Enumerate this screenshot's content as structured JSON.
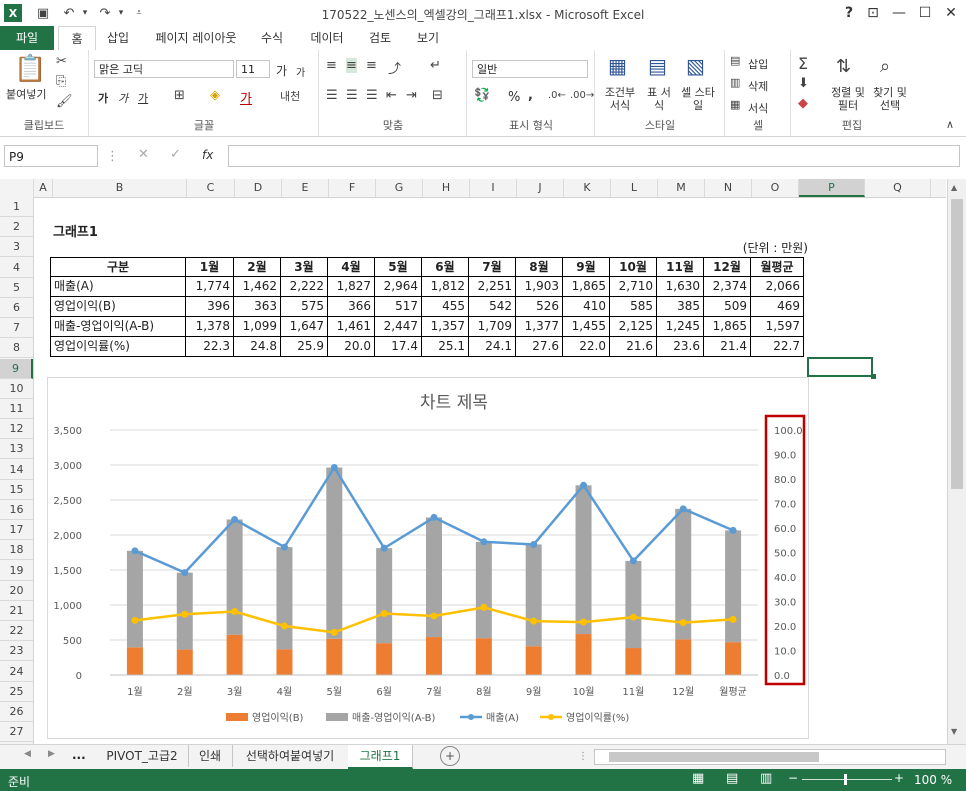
{
  "titlebar": {
    "title": "170522_노센스의_엑셀강의_그래프1.xlsx - Microsoft Excel",
    "help": "?",
    "minimize": "—",
    "maximize": "☐",
    "close": "✕"
  },
  "tabs": [
    "파일",
    "홈",
    "삽입",
    "페이지 레이아웃",
    "수식",
    "데이터",
    "검토",
    "보기"
  ],
  "ribbon": {
    "clipboard": {
      "paste": "붙여넣기",
      "label": "클립보드"
    },
    "font": {
      "name": "맑은 고딕",
      "size": "11",
      "grow": "가",
      "shrink": "가",
      "bold": "가",
      "italic": "가",
      "underline": "가",
      "label": "글꼴"
    },
    "alignment": {
      "label": "맞춤"
    },
    "number": {
      "format": "일반",
      "label": "표시 형식",
      "percent": "%",
      "comma": ","
    },
    "styles": {
      "conditional": "조건부 서식",
      "table": "표 서식",
      "cell": "셀 스타일",
      "label": "스타일"
    },
    "cells": {
      "insert": "삽입",
      "delete": "삭제",
      "format": "서식",
      "label": "셀"
    },
    "editing": {
      "sort": "정렬 및 필터",
      "find": "찾기 및 선택",
      "label": "편집"
    }
  },
  "formula_bar": {
    "name_box": "P9",
    "fx": "fx",
    "value": ""
  },
  "columns": [
    "A",
    "B",
    "C",
    "D",
    "E",
    "F",
    "G",
    "H",
    "I",
    "J",
    "K",
    "L",
    "M",
    "N",
    "O",
    "P",
    "Q"
  ],
  "rows": [
    "1",
    "2",
    "3",
    "4",
    "5",
    "6",
    "7",
    "8",
    "9",
    "10",
    "11",
    "12",
    "13",
    "14",
    "15",
    "16",
    "17",
    "18",
    "19",
    "20",
    "21",
    "22",
    "23",
    "24",
    "25",
    "26",
    "27"
  ],
  "sheet": {
    "title": "그래프1",
    "unit": "(단위 : 만원)",
    "header": [
      "구분",
      "1월",
      "2월",
      "3월",
      "4월",
      "5월",
      "6월",
      "7월",
      "8월",
      "9월",
      "10월",
      "11월",
      "12월",
      "월평균"
    ],
    "rows": [
      [
        "매출(A)",
        "1,774",
        "1,462",
        "2,222",
        "1,827",
        "2,964",
        "1,812",
        "2,251",
        "1,903",
        "1,865",
        "2,710",
        "1,630",
        "2,374",
        "2,066"
      ],
      [
        "영업이익(B)",
        "396",
        "363",
        "575",
        "366",
        "517",
        "455",
        "542",
        "526",
        "410",
        "585",
        "385",
        "509",
        "469"
      ],
      [
        "매출-영업이익(A-B)",
        "1,378",
        "1,099",
        "1,647",
        "1,461",
        "2,447",
        "1,357",
        "1,709",
        "1,377",
        "1,455",
        "2,125",
        "1,245",
        "1,865",
        "1,597"
      ],
      [
        "영업이익률(%)",
        "22.3",
        "24.8",
        "25.9",
        "20.0",
        "17.4",
        "25.1",
        "24.1",
        "27.6",
        "22.0",
        "21.6",
        "23.6",
        "21.4",
        "22.7"
      ]
    ]
  },
  "chart_data": {
    "type": "bar",
    "title": "차트 제목",
    "categories": [
      "1월",
      "2월",
      "3월",
      "4월",
      "5월",
      "6월",
      "7월",
      "8월",
      "9월",
      "10월",
      "11월",
      "12월",
      "월평균"
    ],
    "series": [
      {
        "name": "영업이익(B)",
        "kind": "stacked-bar",
        "color": "#ED7D31",
        "values": [
          396,
          363,
          575,
          366,
          517,
          455,
          542,
          526,
          410,
          585,
          385,
          509,
          469
        ]
      },
      {
        "name": "매출-영업이익(A-B)",
        "kind": "stacked-bar",
        "color": "#A5A5A5",
        "values": [
          1378,
          1099,
          1647,
          1461,
          2447,
          1357,
          1709,
          1377,
          1455,
          2125,
          1245,
          1865,
          1597
        ]
      },
      {
        "name": "매출(A)",
        "kind": "line",
        "color": "#5B9BD5",
        "values": [
          1774,
          1462,
          2222,
          1827,
          2964,
          1812,
          2251,
          1903,
          1865,
          2710,
          1630,
          2374,
          2066
        ]
      },
      {
        "name": "영업이익률(%)",
        "kind": "line-secondary",
        "color": "#FFC000",
        "values": [
          22.3,
          24.8,
          25.9,
          20.0,
          17.4,
          25.1,
          24.1,
          27.6,
          22.0,
          21.6,
          23.6,
          21.4,
          22.7
        ]
      }
    ],
    "ylim": [
      0,
      3500
    ],
    "yticks": [
      "0",
      "500",
      "1,000",
      "1,500",
      "2,000",
      "2,500",
      "3,000",
      "3,500"
    ],
    "y2lim": [
      0,
      100
    ],
    "y2ticks": [
      "0.0",
      "10.0",
      "20.0",
      "30.0",
      "40.0",
      "50.0",
      "60.0",
      "70.0",
      "80.0",
      "90.0",
      "100.0"
    ],
    "legend_position": "bottom",
    "grid": true,
    "highlight_color": "#C00000"
  },
  "sheet_tabs": {
    "items": [
      "PIVOT_고급2",
      "인쇄",
      "선택하여붙여넣기",
      "그래프1"
    ],
    "active": "그래프1",
    "ellipsis": "...",
    "add": "+"
  },
  "status": {
    "ready": "준비",
    "zoom": "100 %"
  }
}
